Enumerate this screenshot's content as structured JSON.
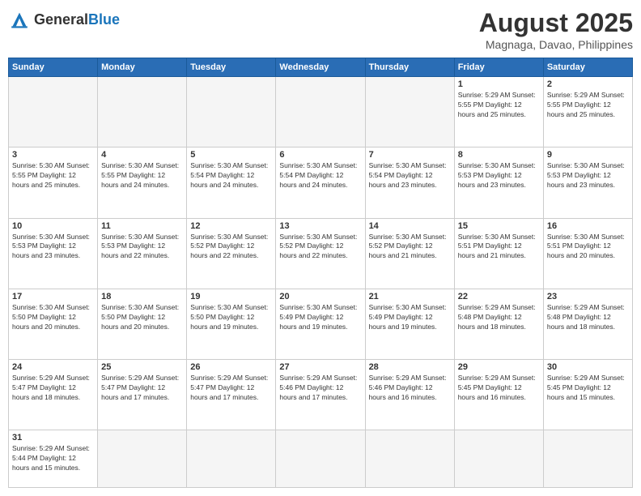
{
  "header": {
    "logo_general": "General",
    "logo_blue": "Blue",
    "month_year": "August 2025",
    "location": "Magnaga, Davao, Philippines"
  },
  "weekdays": [
    "Sunday",
    "Monday",
    "Tuesday",
    "Wednesday",
    "Thursday",
    "Friday",
    "Saturday"
  ],
  "weeks": [
    [
      {
        "day": "",
        "info": ""
      },
      {
        "day": "",
        "info": ""
      },
      {
        "day": "",
        "info": ""
      },
      {
        "day": "",
        "info": ""
      },
      {
        "day": "",
        "info": ""
      },
      {
        "day": "1",
        "info": "Sunrise: 5:29 AM\nSunset: 5:55 PM\nDaylight: 12 hours\nand 25 minutes."
      },
      {
        "day": "2",
        "info": "Sunrise: 5:29 AM\nSunset: 5:55 PM\nDaylight: 12 hours\nand 25 minutes."
      }
    ],
    [
      {
        "day": "3",
        "info": "Sunrise: 5:30 AM\nSunset: 5:55 PM\nDaylight: 12 hours\nand 25 minutes."
      },
      {
        "day": "4",
        "info": "Sunrise: 5:30 AM\nSunset: 5:55 PM\nDaylight: 12 hours\nand 24 minutes."
      },
      {
        "day": "5",
        "info": "Sunrise: 5:30 AM\nSunset: 5:54 PM\nDaylight: 12 hours\nand 24 minutes."
      },
      {
        "day": "6",
        "info": "Sunrise: 5:30 AM\nSunset: 5:54 PM\nDaylight: 12 hours\nand 24 minutes."
      },
      {
        "day": "7",
        "info": "Sunrise: 5:30 AM\nSunset: 5:54 PM\nDaylight: 12 hours\nand 23 minutes."
      },
      {
        "day": "8",
        "info": "Sunrise: 5:30 AM\nSunset: 5:53 PM\nDaylight: 12 hours\nand 23 minutes."
      },
      {
        "day": "9",
        "info": "Sunrise: 5:30 AM\nSunset: 5:53 PM\nDaylight: 12 hours\nand 23 minutes."
      }
    ],
    [
      {
        "day": "10",
        "info": "Sunrise: 5:30 AM\nSunset: 5:53 PM\nDaylight: 12 hours\nand 23 minutes."
      },
      {
        "day": "11",
        "info": "Sunrise: 5:30 AM\nSunset: 5:53 PM\nDaylight: 12 hours\nand 22 minutes."
      },
      {
        "day": "12",
        "info": "Sunrise: 5:30 AM\nSunset: 5:52 PM\nDaylight: 12 hours\nand 22 minutes."
      },
      {
        "day": "13",
        "info": "Sunrise: 5:30 AM\nSunset: 5:52 PM\nDaylight: 12 hours\nand 22 minutes."
      },
      {
        "day": "14",
        "info": "Sunrise: 5:30 AM\nSunset: 5:52 PM\nDaylight: 12 hours\nand 21 minutes."
      },
      {
        "day": "15",
        "info": "Sunrise: 5:30 AM\nSunset: 5:51 PM\nDaylight: 12 hours\nand 21 minutes."
      },
      {
        "day": "16",
        "info": "Sunrise: 5:30 AM\nSunset: 5:51 PM\nDaylight: 12 hours\nand 20 minutes."
      }
    ],
    [
      {
        "day": "17",
        "info": "Sunrise: 5:30 AM\nSunset: 5:50 PM\nDaylight: 12 hours\nand 20 minutes."
      },
      {
        "day": "18",
        "info": "Sunrise: 5:30 AM\nSunset: 5:50 PM\nDaylight: 12 hours\nand 20 minutes."
      },
      {
        "day": "19",
        "info": "Sunrise: 5:30 AM\nSunset: 5:50 PM\nDaylight: 12 hours\nand 19 minutes."
      },
      {
        "day": "20",
        "info": "Sunrise: 5:30 AM\nSunset: 5:49 PM\nDaylight: 12 hours\nand 19 minutes."
      },
      {
        "day": "21",
        "info": "Sunrise: 5:30 AM\nSunset: 5:49 PM\nDaylight: 12 hours\nand 19 minutes."
      },
      {
        "day": "22",
        "info": "Sunrise: 5:29 AM\nSunset: 5:48 PM\nDaylight: 12 hours\nand 18 minutes."
      },
      {
        "day": "23",
        "info": "Sunrise: 5:29 AM\nSunset: 5:48 PM\nDaylight: 12 hours\nand 18 minutes."
      }
    ],
    [
      {
        "day": "24",
        "info": "Sunrise: 5:29 AM\nSunset: 5:47 PM\nDaylight: 12 hours\nand 18 minutes."
      },
      {
        "day": "25",
        "info": "Sunrise: 5:29 AM\nSunset: 5:47 PM\nDaylight: 12 hours\nand 17 minutes."
      },
      {
        "day": "26",
        "info": "Sunrise: 5:29 AM\nSunset: 5:47 PM\nDaylight: 12 hours\nand 17 minutes."
      },
      {
        "day": "27",
        "info": "Sunrise: 5:29 AM\nSunset: 5:46 PM\nDaylight: 12 hours\nand 17 minutes."
      },
      {
        "day": "28",
        "info": "Sunrise: 5:29 AM\nSunset: 5:46 PM\nDaylight: 12 hours\nand 16 minutes."
      },
      {
        "day": "29",
        "info": "Sunrise: 5:29 AM\nSunset: 5:45 PM\nDaylight: 12 hours\nand 16 minutes."
      },
      {
        "day": "30",
        "info": "Sunrise: 5:29 AM\nSunset: 5:45 PM\nDaylight: 12 hours\nand 15 minutes."
      }
    ],
    [
      {
        "day": "31",
        "info": "Sunrise: 5:29 AM\nSunset: 5:44 PM\nDaylight: 12 hours\nand 15 minutes."
      },
      {
        "day": "",
        "info": ""
      },
      {
        "day": "",
        "info": ""
      },
      {
        "day": "",
        "info": ""
      },
      {
        "day": "",
        "info": ""
      },
      {
        "day": "",
        "info": ""
      },
      {
        "day": "",
        "info": ""
      }
    ]
  ]
}
